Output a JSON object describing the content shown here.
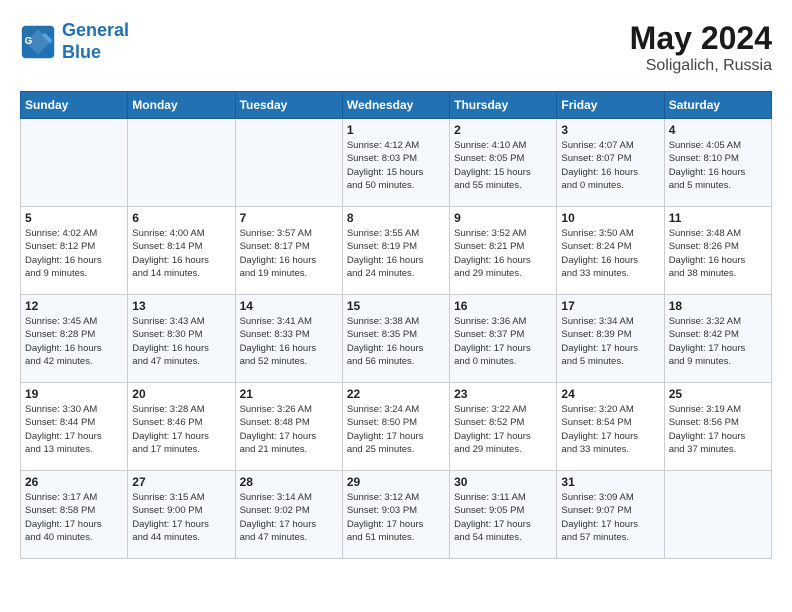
{
  "header": {
    "logo_line1": "General",
    "logo_line2": "Blue",
    "month": "May 2024",
    "location": "Soligalich, Russia"
  },
  "days_of_week": [
    "Sunday",
    "Monday",
    "Tuesday",
    "Wednesday",
    "Thursday",
    "Friday",
    "Saturday"
  ],
  "weeks": [
    [
      {
        "day": "",
        "info": ""
      },
      {
        "day": "",
        "info": ""
      },
      {
        "day": "",
        "info": ""
      },
      {
        "day": "1",
        "info": "Sunrise: 4:12 AM\nSunset: 8:03 PM\nDaylight: 15 hours\nand 50 minutes."
      },
      {
        "day": "2",
        "info": "Sunrise: 4:10 AM\nSunset: 8:05 PM\nDaylight: 15 hours\nand 55 minutes."
      },
      {
        "day": "3",
        "info": "Sunrise: 4:07 AM\nSunset: 8:07 PM\nDaylight: 16 hours\nand 0 minutes."
      },
      {
        "day": "4",
        "info": "Sunrise: 4:05 AM\nSunset: 8:10 PM\nDaylight: 16 hours\nand 5 minutes."
      }
    ],
    [
      {
        "day": "5",
        "info": "Sunrise: 4:02 AM\nSunset: 8:12 PM\nDaylight: 16 hours\nand 9 minutes."
      },
      {
        "day": "6",
        "info": "Sunrise: 4:00 AM\nSunset: 8:14 PM\nDaylight: 16 hours\nand 14 minutes."
      },
      {
        "day": "7",
        "info": "Sunrise: 3:57 AM\nSunset: 8:17 PM\nDaylight: 16 hours\nand 19 minutes."
      },
      {
        "day": "8",
        "info": "Sunrise: 3:55 AM\nSunset: 8:19 PM\nDaylight: 16 hours\nand 24 minutes."
      },
      {
        "day": "9",
        "info": "Sunrise: 3:52 AM\nSunset: 8:21 PM\nDaylight: 16 hours\nand 29 minutes."
      },
      {
        "day": "10",
        "info": "Sunrise: 3:50 AM\nSunset: 8:24 PM\nDaylight: 16 hours\nand 33 minutes."
      },
      {
        "day": "11",
        "info": "Sunrise: 3:48 AM\nSunset: 8:26 PM\nDaylight: 16 hours\nand 38 minutes."
      }
    ],
    [
      {
        "day": "12",
        "info": "Sunrise: 3:45 AM\nSunset: 8:28 PM\nDaylight: 16 hours\nand 42 minutes."
      },
      {
        "day": "13",
        "info": "Sunrise: 3:43 AM\nSunset: 8:30 PM\nDaylight: 16 hours\nand 47 minutes."
      },
      {
        "day": "14",
        "info": "Sunrise: 3:41 AM\nSunset: 8:33 PM\nDaylight: 16 hours\nand 52 minutes."
      },
      {
        "day": "15",
        "info": "Sunrise: 3:38 AM\nSunset: 8:35 PM\nDaylight: 16 hours\nand 56 minutes."
      },
      {
        "day": "16",
        "info": "Sunrise: 3:36 AM\nSunset: 8:37 PM\nDaylight: 17 hours\nand 0 minutes."
      },
      {
        "day": "17",
        "info": "Sunrise: 3:34 AM\nSunset: 8:39 PM\nDaylight: 17 hours\nand 5 minutes."
      },
      {
        "day": "18",
        "info": "Sunrise: 3:32 AM\nSunset: 8:42 PM\nDaylight: 17 hours\nand 9 minutes."
      }
    ],
    [
      {
        "day": "19",
        "info": "Sunrise: 3:30 AM\nSunset: 8:44 PM\nDaylight: 17 hours\nand 13 minutes."
      },
      {
        "day": "20",
        "info": "Sunrise: 3:28 AM\nSunset: 8:46 PM\nDaylight: 17 hours\nand 17 minutes."
      },
      {
        "day": "21",
        "info": "Sunrise: 3:26 AM\nSunset: 8:48 PM\nDaylight: 17 hours\nand 21 minutes."
      },
      {
        "day": "22",
        "info": "Sunrise: 3:24 AM\nSunset: 8:50 PM\nDaylight: 17 hours\nand 25 minutes."
      },
      {
        "day": "23",
        "info": "Sunrise: 3:22 AM\nSunset: 8:52 PM\nDaylight: 17 hours\nand 29 minutes."
      },
      {
        "day": "24",
        "info": "Sunrise: 3:20 AM\nSunset: 8:54 PM\nDaylight: 17 hours\nand 33 minutes."
      },
      {
        "day": "25",
        "info": "Sunrise: 3:19 AM\nSunset: 8:56 PM\nDaylight: 17 hours\nand 37 minutes."
      }
    ],
    [
      {
        "day": "26",
        "info": "Sunrise: 3:17 AM\nSunset: 8:58 PM\nDaylight: 17 hours\nand 40 minutes."
      },
      {
        "day": "27",
        "info": "Sunrise: 3:15 AM\nSunset: 9:00 PM\nDaylight: 17 hours\nand 44 minutes."
      },
      {
        "day": "28",
        "info": "Sunrise: 3:14 AM\nSunset: 9:02 PM\nDaylight: 17 hours\nand 47 minutes."
      },
      {
        "day": "29",
        "info": "Sunrise: 3:12 AM\nSunset: 9:03 PM\nDaylight: 17 hours\nand 51 minutes."
      },
      {
        "day": "30",
        "info": "Sunrise: 3:11 AM\nSunset: 9:05 PM\nDaylight: 17 hours\nand 54 minutes."
      },
      {
        "day": "31",
        "info": "Sunrise: 3:09 AM\nSunset: 9:07 PM\nDaylight: 17 hours\nand 57 minutes."
      },
      {
        "day": "",
        "info": ""
      }
    ]
  ]
}
